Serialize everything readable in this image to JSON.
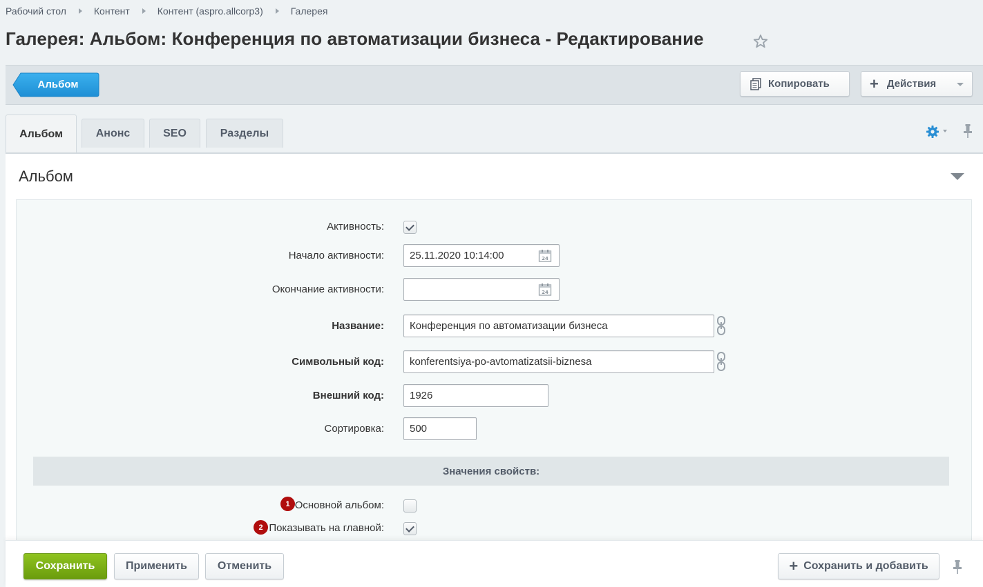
{
  "breadcrumbs": [
    "Рабочий стол",
    "Контент",
    "Контент (aspro.allcorp3)",
    "Галерея"
  ],
  "page_title": "Галерея: Альбом: Конференция по автоматизации бизнеса - Редактирование",
  "toolbar": {
    "back_label": "Альбом",
    "copy_label": "Копировать",
    "actions_label": "Действия"
  },
  "tabs": [
    "Альбом",
    "Анонс",
    "SEO",
    "Разделы"
  ],
  "section_title": "Альбом",
  "fields": {
    "active_label": "Активность:",
    "active_checked": true,
    "start_label": "Начало активности:",
    "start_value": "25.11.2020 10:14:00",
    "end_label": "Окончание активности:",
    "end_value": "",
    "name_label": "Название:",
    "name_value": "Конференция по автоматизации бизнеса",
    "code_label": "Символьный код:",
    "code_value": "konferentsiya-po-avtomatizatsii-biznesa",
    "ext_label": "Внешний код:",
    "ext_value": "1926",
    "sort_label": "Сортировка:",
    "sort_value": "500"
  },
  "properties": {
    "header": "Значения свойств:",
    "main_album_badge": "1",
    "main_album_label": "Основной альбом:",
    "main_album_checked": false,
    "show_main_badge": "2",
    "show_main_label": "Показывать на главной:",
    "show_main_checked": true
  },
  "bottom": {
    "save": "Сохранить",
    "apply": "Применить",
    "cancel": "Отменить",
    "save_add": "Сохранить и добавить"
  },
  "colors": {
    "back_button": "#2fa4e7",
    "save_button": "#7fb315",
    "badge": "#b00d0d"
  }
}
